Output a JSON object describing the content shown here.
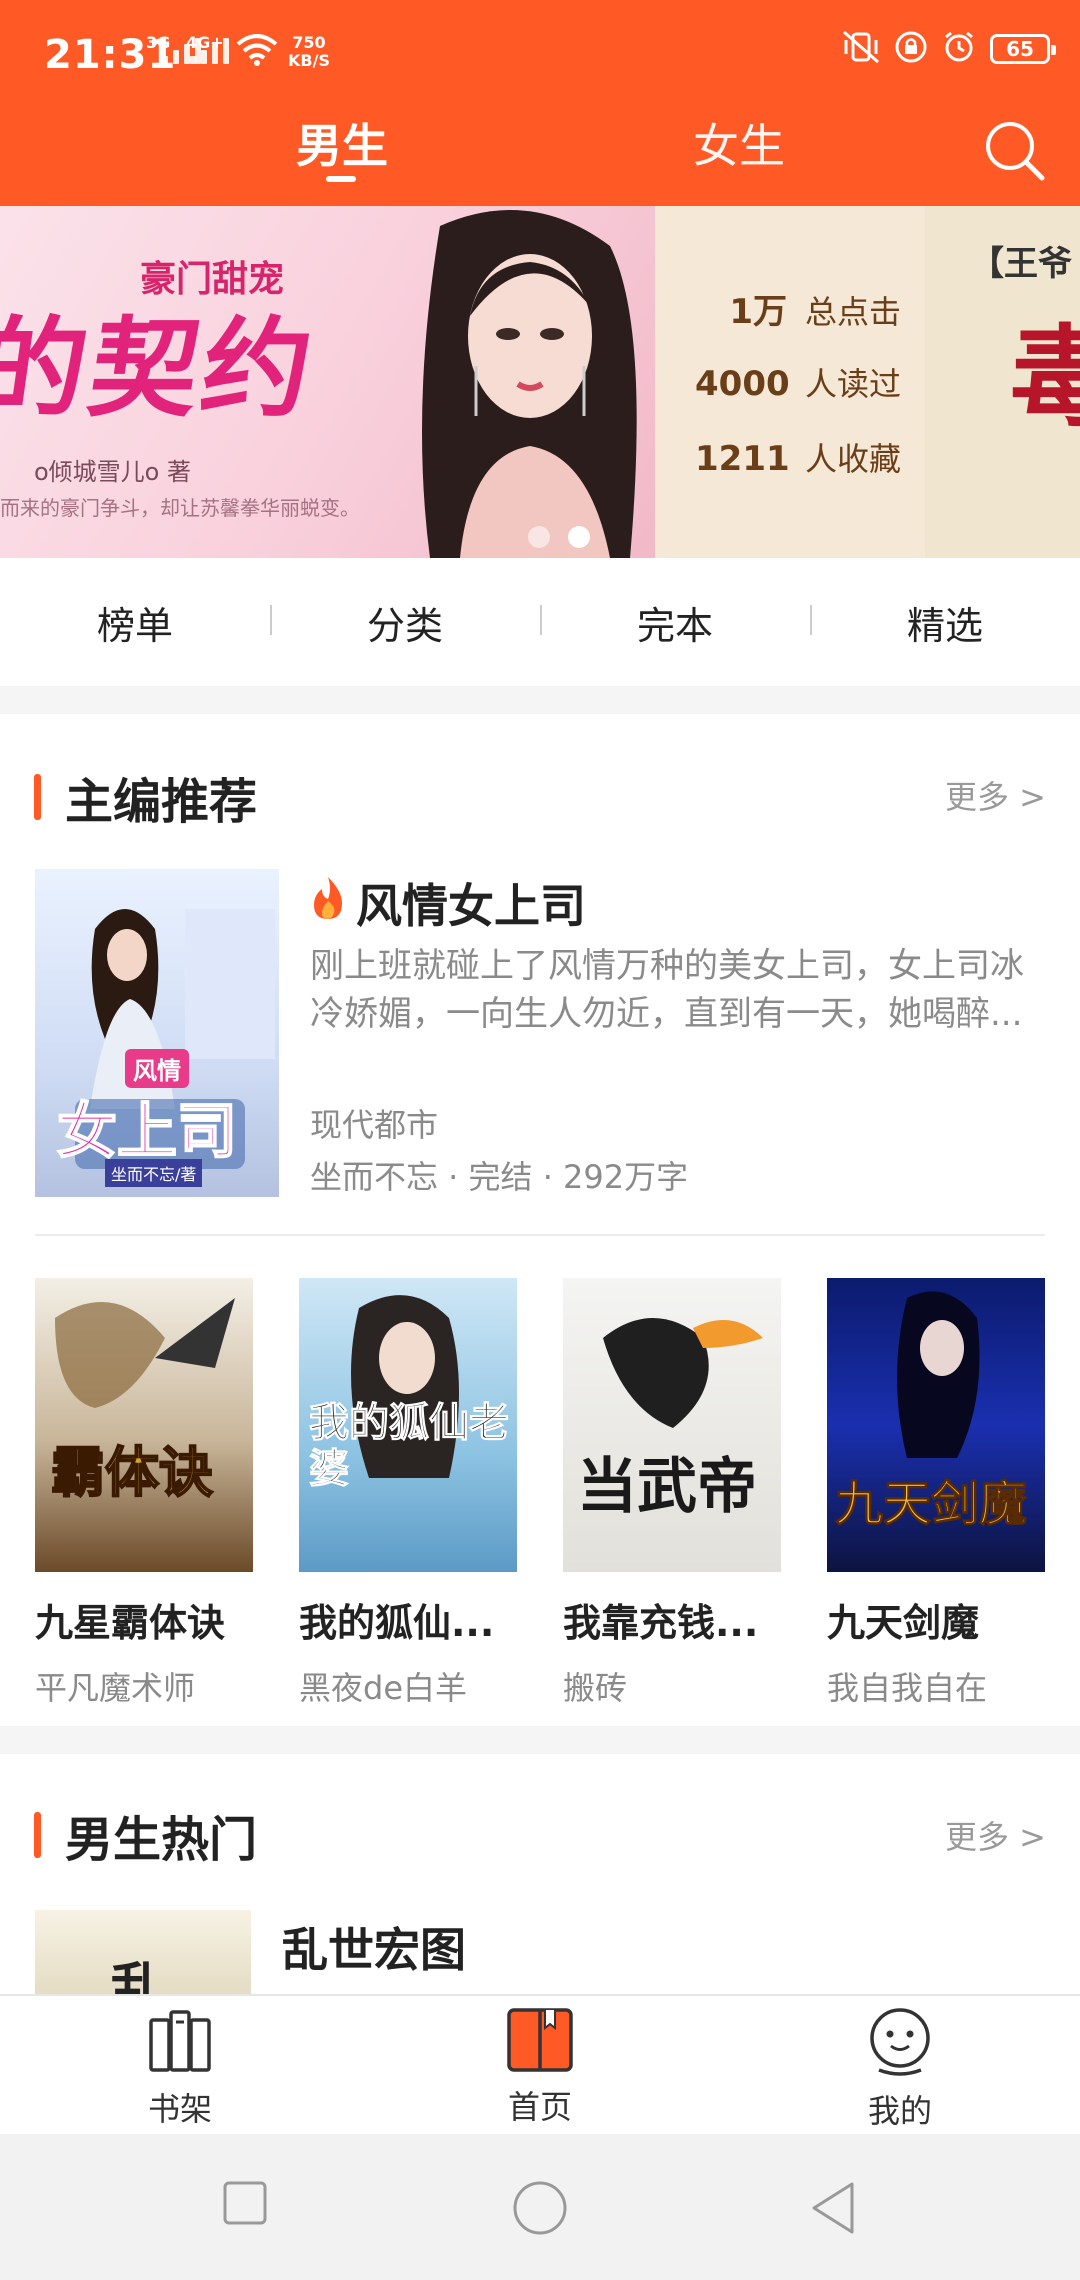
{
  "status_bar": {
    "time": "21:31",
    "network_3g": "3G",
    "network_4g": "4G+",
    "speed_value": "750",
    "speed_unit": "KB/S",
    "battery": "65"
  },
  "top_tabs": {
    "male": "男生",
    "female": "女生",
    "active": "男生"
  },
  "banner": {
    "tagline": "豪门甜宠",
    "big_title": "的契约",
    "author": "o倾城雪儿o 著",
    "blurb": "而来的豪门争斗，却让苏馨拳华丽蜕变。",
    "stats": [
      {
        "num": "1万",
        "label": "总点击"
      },
      {
        "num": "4000",
        "label": "人读过"
      },
      {
        "num": "1211",
        "label": "人收藏"
      }
    ],
    "next_title": "【王爷",
    "next_big": "毒",
    "active_dot": 2,
    "dot_count": 2
  },
  "quick_nav": [
    "榜单",
    "分类",
    "完本",
    "精选"
  ],
  "editor_pick": {
    "section_title": "主编推荐",
    "more": "更多 >",
    "feature": {
      "title": "风情女上司",
      "description": "刚上班就碰上了风情万种的美女上司，女上司冰冷娇媚，一向生人勿近，直到有一天，她喝醉...",
      "genre": "现代都市",
      "meta": "坐而不忘 · 完结 · 292万字",
      "cover_text_top": "风情",
      "cover_text_main": "女上司",
      "cover_author": "坐而不忘/著"
    },
    "books": [
      {
        "name": "九星霸体诀",
        "author": "平凡魔术师",
        "cover_text": "霸体诀"
      },
      {
        "name": "我的狐仙...",
        "author": "黑夜de白羊",
        "cover_text": "我的狐仙老婆"
      },
      {
        "name": "我靠充钱...",
        "author": "搬砖",
        "cover_text": "当武帝"
      },
      {
        "name": "九天剑魔",
        "author": "我自我自在",
        "cover_text": "九天剑魔"
      }
    ]
  },
  "male_hot": {
    "section_title": "男生热门",
    "more": "更多 >",
    "first_title": "乱世宏图",
    "cover_text": "乱"
  },
  "bottom_nav": {
    "shelf": "书架",
    "home": "首页",
    "mine": "我的",
    "active": "首页"
  },
  "colors": {
    "brand": "#ff5a26",
    "muted_text": "#8a8a8a"
  }
}
